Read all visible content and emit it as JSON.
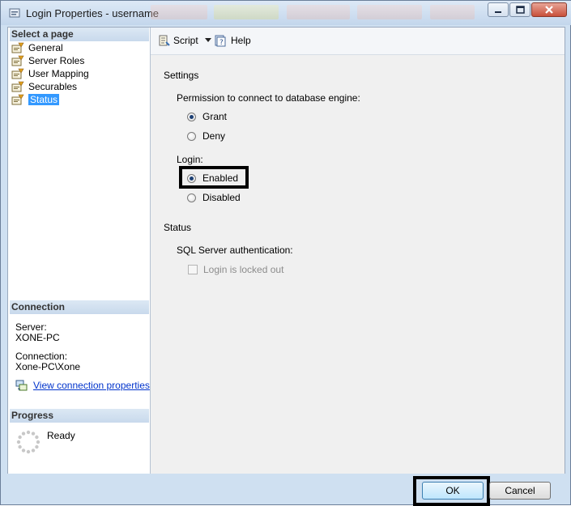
{
  "window": {
    "title": "Login Properties - username"
  },
  "sidebar": {
    "select_header": "Select a page",
    "pages": [
      {
        "label": "General"
      },
      {
        "label": "Server Roles"
      },
      {
        "label": "User Mapping"
      },
      {
        "label": "Securables"
      },
      {
        "label": "Status",
        "selected": true
      }
    ],
    "connection": {
      "header": "Connection",
      "server_label": "Server:",
      "server_value": "XONE-PC",
      "connection_label": "Connection:",
      "connection_value": "Xone-PC\\Xone",
      "link": "View connection properties"
    },
    "progress": {
      "header": "Progress",
      "status": "Ready"
    }
  },
  "toolbar": {
    "script": "Script",
    "help": "Help"
  },
  "settings": {
    "heading": "Settings",
    "permission_label": "Permission to connect to database engine:",
    "permission_options": [
      {
        "label": "Grant",
        "checked": true
      },
      {
        "label": "Deny",
        "checked": false
      }
    ],
    "login_label": "Login:",
    "login_options": [
      {
        "label": "Enabled",
        "checked": true
      },
      {
        "label": "Disabled",
        "checked": false
      }
    ]
  },
  "status": {
    "heading": "Status",
    "auth_label": "SQL Server authentication:",
    "locked_label": "Login is locked out",
    "locked_checked": false
  },
  "buttons": {
    "ok": "OK",
    "cancel": "Cancel"
  },
  "colors": {
    "selection": "#3399ff",
    "link": "#0033cc",
    "header_bg": "#c8d9ec"
  },
  "icons": [
    "window-app-icon",
    "page-properties-icon",
    "script-icon",
    "dropdown-arrow-icon",
    "help-icon",
    "connection-properties-icon",
    "progress-spinner-icon",
    "minimize-icon",
    "maximize-icon",
    "close-icon"
  ]
}
